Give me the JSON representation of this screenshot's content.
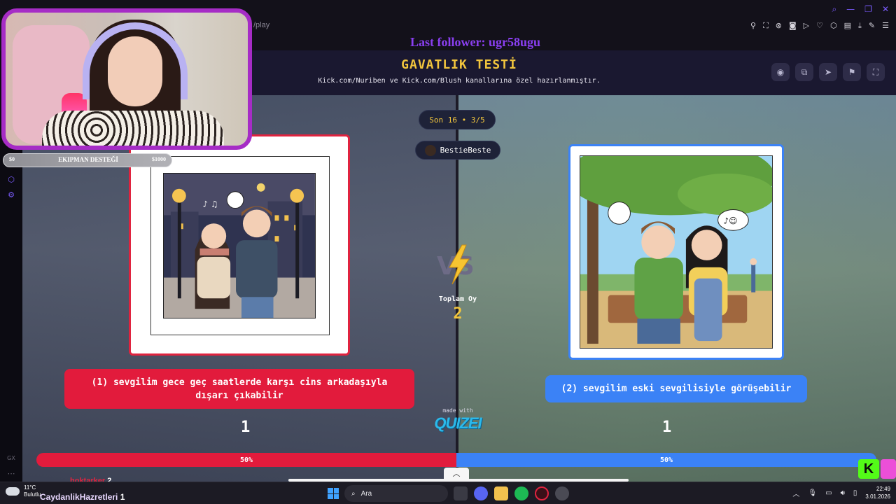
{
  "browser": {
    "url_suffix": "/play"
  },
  "overlay": {
    "last_follower": "Last follower: ugr58ugu",
    "donation": {
      "min": "$0",
      "title": "EKIPMAN DESTEĞİ",
      "max": "$1000"
    },
    "chat_user": "hoktarker",
    "chat_count": "2"
  },
  "quiz": {
    "title": "GAVATLIK TESTİ",
    "subtitle": "Kick.com/Nuriben ve Kick.com/Blush kanallarına özel hazırlanmıştır.",
    "round": "Son 16 • 3/5",
    "player": "BestieBeste",
    "vs_label": "VS",
    "total_label": "Toplam Oy",
    "total_value": "2",
    "options": [
      {
        "text": "(1) sevgilim gece geç saatlerde karşı cins arkadaşıyla dışarı çıkabilir",
        "votes": "1",
        "percent_label": "50%",
        "color": "#e21b3c"
      },
      {
        "text": "(2) sevgilim eski sevgilisiyle görüşebilir",
        "votes": "1",
        "percent_label": "50%",
        "color": "#3b82f6"
      }
    ],
    "made_with": "made with",
    "brand": "QUIZEI",
    "split": 0.5,
    "icons": [
      "eye-icon",
      "share-icon",
      "send-icon",
      "flag-icon",
      "fullscreen-icon"
    ]
  },
  "taskbar": {
    "temperature": "11°C",
    "weather_desc": "Bulutlu",
    "viewer_name": "CaydanlikHazretleri",
    "viewer_count": "1",
    "search_placeholder": "Ara",
    "time": "22:49",
    "date": "3.01.2026"
  }
}
